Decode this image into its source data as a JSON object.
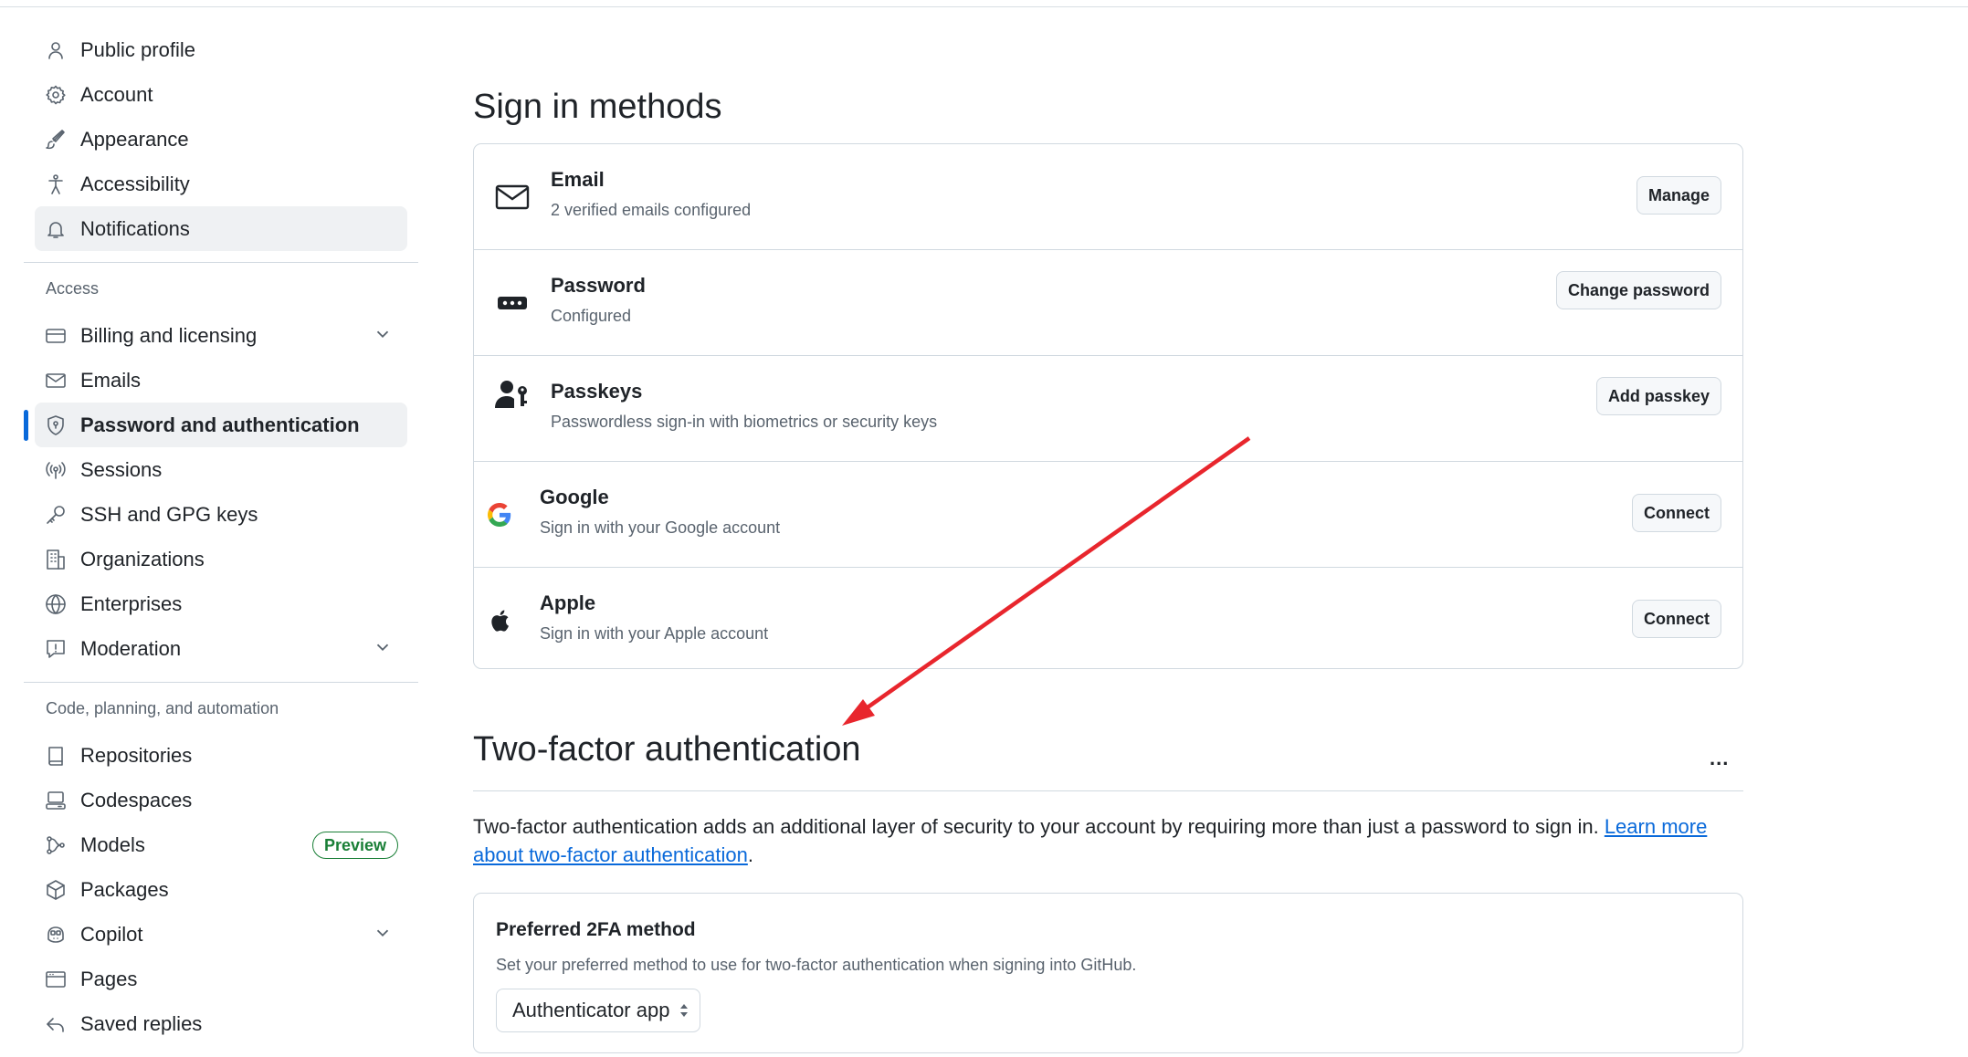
{
  "sidebar": {
    "top_items": [
      {
        "label": "Public profile",
        "icon": "person-icon"
      },
      {
        "label": "Account",
        "icon": "gear-icon"
      },
      {
        "label": "Appearance",
        "icon": "paintbrush-icon"
      },
      {
        "label": "Accessibility",
        "icon": "accessibility-icon"
      },
      {
        "label": "Notifications",
        "icon": "bell-icon"
      }
    ],
    "access_title": "Access",
    "access_items": [
      {
        "label": "Billing and licensing",
        "icon": "credit-card-icon"
      },
      {
        "label": "Emails",
        "icon": "mail-icon"
      },
      {
        "label": "Password and authentication",
        "icon": "shield-lock-icon"
      },
      {
        "label": "Sessions",
        "icon": "broadcast-icon"
      },
      {
        "label": "SSH and GPG keys",
        "icon": "key-icon"
      },
      {
        "label": "Organizations",
        "icon": "organization-icon"
      },
      {
        "label": "Enterprises",
        "icon": "globe-icon"
      },
      {
        "label": "Moderation",
        "icon": "report-icon"
      }
    ],
    "code_title": "Code, planning, and automation",
    "code_items": [
      {
        "label": "Repositories",
        "icon": "repo-icon"
      },
      {
        "label": "Codespaces",
        "icon": "codespaces-icon"
      },
      {
        "label": "Models",
        "icon": "models-icon",
        "badge": "Preview"
      },
      {
        "label": "Packages",
        "icon": "package-icon"
      },
      {
        "label": "Copilot",
        "icon": "copilot-icon"
      },
      {
        "label": "Pages",
        "icon": "browser-icon"
      },
      {
        "label": "Saved replies",
        "icon": "reply-icon"
      }
    ]
  },
  "signin": {
    "title": "Sign in methods",
    "methods": [
      {
        "title": "Email",
        "subtitle": "2 verified emails configured",
        "button": "Manage",
        "icon": "mail-icon"
      },
      {
        "title": "Password",
        "subtitle": "Configured",
        "button": "Change password",
        "icon": "password-icon"
      },
      {
        "title": "Passkeys",
        "subtitle": "Passwordless sign-in with biometrics or security keys",
        "button": "Add passkey",
        "icon": "passkey-icon"
      },
      {
        "title": "Google",
        "subtitle": "Sign in with your Google account",
        "button": "Connect",
        "icon": "google-icon"
      },
      {
        "title": "Apple",
        "subtitle": "Sign in with your Apple account",
        "button": "Connect",
        "icon": "apple-icon"
      }
    ]
  },
  "twofa": {
    "title": "Two-factor authentication",
    "menu_dots": "...",
    "description": "Two-factor authentication adds an additional layer of security to your account by requiring more than just a password to sign in.",
    "link": "Learn more about two-factor authentication",
    "period": ".",
    "preferred_title": "Preferred 2FA method",
    "preferred_desc": "Set your preferred method to use for two-factor authentication when signing into GitHub.",
    "selected_method": "Authenticator app"
  },
  "colors": {
    "accent": "#0969da",
    "annotation_arrow": "#e8262d",
    "preview_badge": "#1a7f37"
  }
}
